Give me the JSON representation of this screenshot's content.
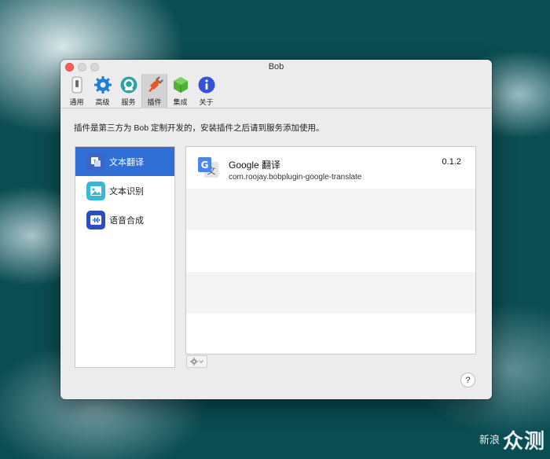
{
  "window": {
    "title": "Bob"
  },
  "toolbar": {
    "items": [
      {
        "label": "通用",
        "icon": "switch-icon"
      },
      {
        "label": "高级",
        "icon": "gear-icon"
      },
      {
        "label": "服务",
        "icon": "service-icon"
      },
      {
        "label": "插件",
        "icon": "plugin-icon",
        "active": true
      },
      {
        "label": "集成",
        "icon": "box-icon"
      },
      {
        "label": "关于",
        "icon": "info-icon"
      }
    ]
  },
  "description": "插件是第三方为 Bob 定制开发的，安装插件之后请到服务添加使用。",
  "sidebar": {
    "items": [
      {
        "label": "文本翻译",
        "icon": "translate-icon",
        "selected": true
      },
      {
        "label": "文本识别",
        "icon": "image-icon"
      },
      {
        "label": "语音合成",
        "icon": "voice-icon"
      }
    ]
  },
  "plugins": [
    {
      "name": "Google 翻译",
      "id": "com.roojay.bobplugin-google-translate",
      "version": "0.1.2",
      "icon": "google-translate-icon"
    }
  ],
  "help_label": "?",
  "watermark": {
    "small": "新浪",
    "big": "众测"
  },
  "colors": {
    "accent": "#2f6fd6",
    "close": "#fc605c"
  }
}
